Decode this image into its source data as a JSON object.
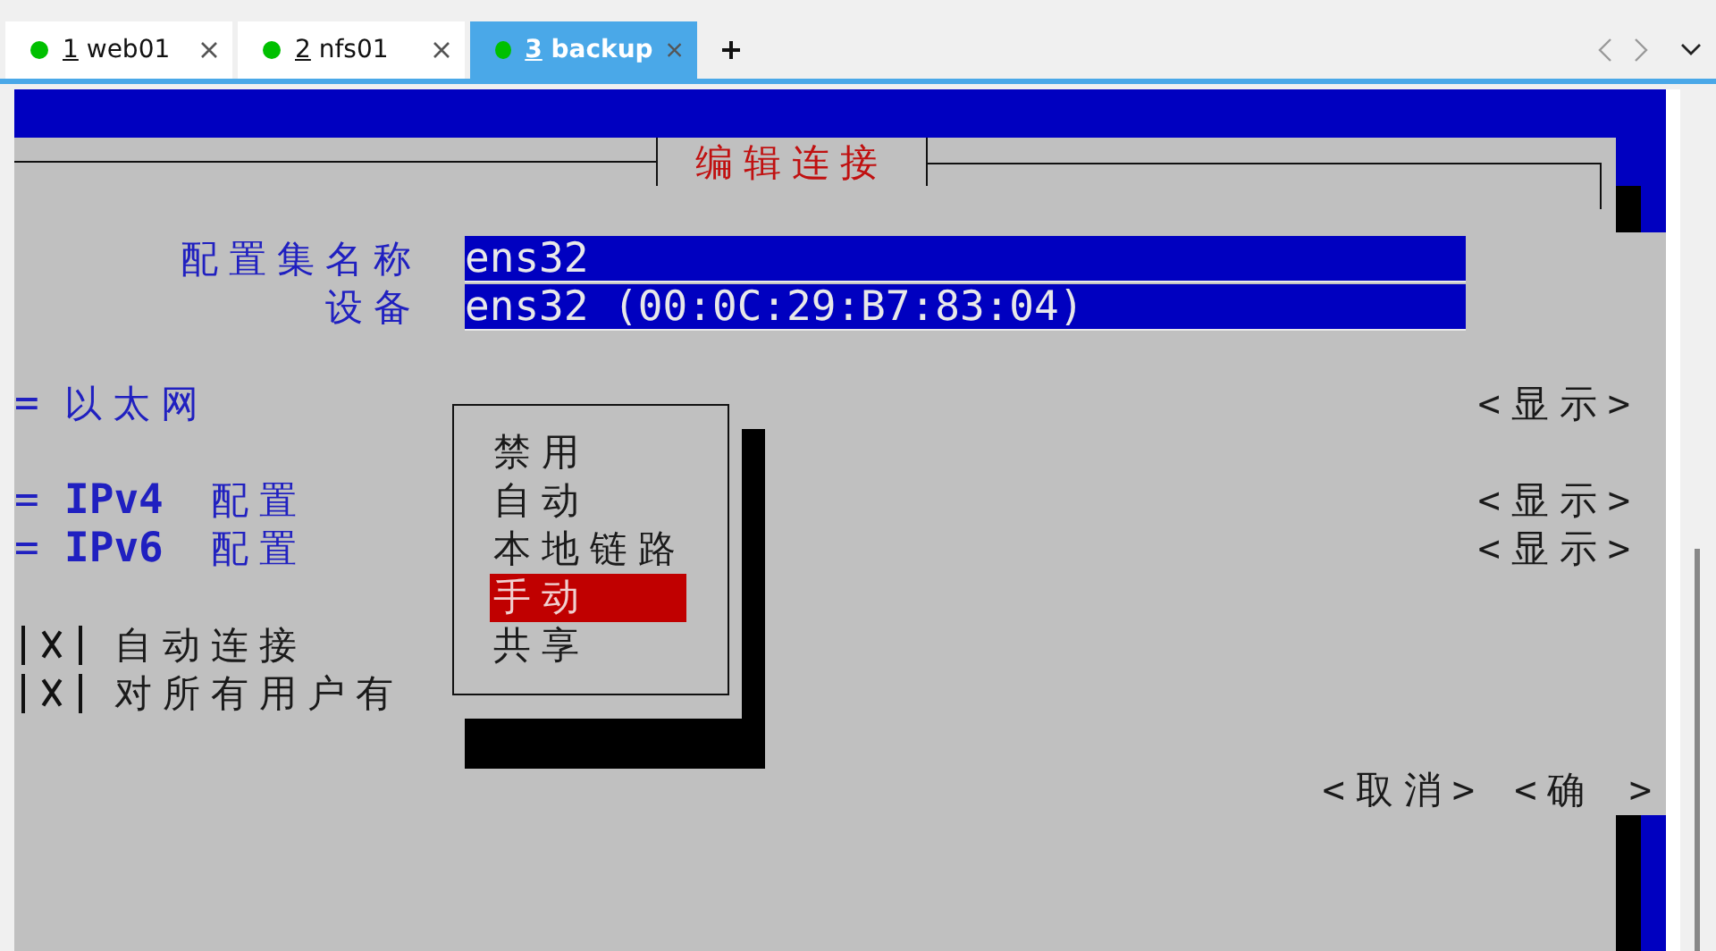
{
  "tabs": [
    {
      "number": "1",
      "label": "web01",
      "selected": false
    },
    {
      "number": "2",
      "label": "nfs01",
      "selected": false
    },
    {
      "number": "3",
      "label": "backup",
      "selected": true
    }
  ],
  "dialog": {
    "title": "编辑连接",
    "fields": [
      {
        "label": "配置集名称",
        "value": "ens32"
      },
      {
        "label": "设备",
        "value": "ens32 (00:0C:29:B7:83:04)"
      }
    ],
    "sections": [
      {
        "marker": "=",
        "label": "以太网",
        "button": "<显示>"
      },
      {
        "marker": "=",
        "label": "**IPv4** 配置",
        "button": "<显示>"
      },
      {
        "marker": "=",
        "label": "**IPv6** 配置",
        "button": "<显示>"
      }
    ],
    "checkboxes": [
      {
        "label": "自动连接",
        "checked": true
      },
      {
        "label": "对所有用户有",
        "checked": true
      }
    ],
    "buttons": [
      "<取消>",
      "<确 >"
    ]
  },
  "menu": {
    "items": [
      {
        "label": "禁用",
        "selected": false
      },
      {
        "label": "自动",
        "selected": false
      },
      {
        "label": "本地链路",
        "selected": false
      },
      {
        "label": "手动",
        "selected": true
      },
      {
        "label": "共享",
        "selected": false
      }
    ]
  }
}
